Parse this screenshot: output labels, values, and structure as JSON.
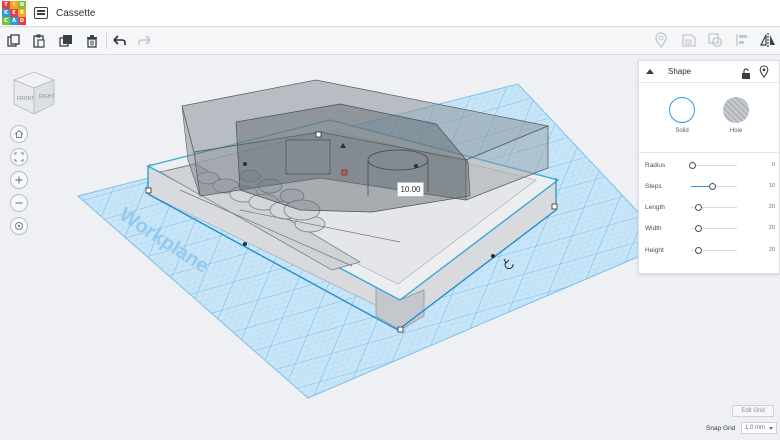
{
  "app": {
    "logo_letters": [
      "T",
      "I",
      "N",
      "K",
      "E",
      "R",
      "C",
      "A",
      "D"
    ],
    "logo_colors": [
      "#e2403a",
      "#f5a623",
      "#7ac142",
      "#2d9be0",
      "#e2403a",
      "#f5a623",
      "#7ac142",
      "#2d9be0",
      "#e2403a"
    ],
    "document_title": "Cassette"
  },
  "toolbar": {
    "left_icons": [
      "copy-icon",
      "paste-icon",
      "duplicate-icon",
      "delete-icon",
      "undo-icon",
      "redo-icon"
    ],
    "right_icons": [
      "note-icon",
      "group-icon",
      "ungroup-icon",
      "align-icon",
      "mirror-icon"
    ]
  },
  "viewcube": {
    "front_label": "FRONT",
    "side_label": "RIGHT"
  },
  "nav_icons": [
    "home-icon",
    "fit-view-icon",
    "zoom-in-icon",
    "zoom-out-icon",
    "view-mode-icon"
  ],
  "workplane": {
    "label": "Workplane",
    "color": "#5aa7e0"
  },
  "dimension_tag": {
    "value": "10.00"
  },
  "inspector": {
    "title": "Shape",
    "solid_label": "Solid",
    "hole_label": "Hole",
    "properties": [
      {
        "label": "Radius",
        "value": "0",
        "fraction": 0.0
      },
      {
        "label": "Steps",
        "value": "10",
        "fraction": 0.45
      },
      {
        "label": "Length",
        "value": "20",
        "fraction": 0.0
      },
      {
        "label": "Width",
        "value": "20",
        "fraction": 0.0
      },
      {
        "label": "Height",
        "value": "20",
        "fraction": 0.0
      }
    ]
  },
  "grid": {
    "edit_label": "Edit Grid",
    "snap_label": "Snap Grid",
    "snap_value": "1.0 mm"
  },
  "colors": {
    "accent": "#2d9be0",
    "selection": "#39b8e6"
  }
}
